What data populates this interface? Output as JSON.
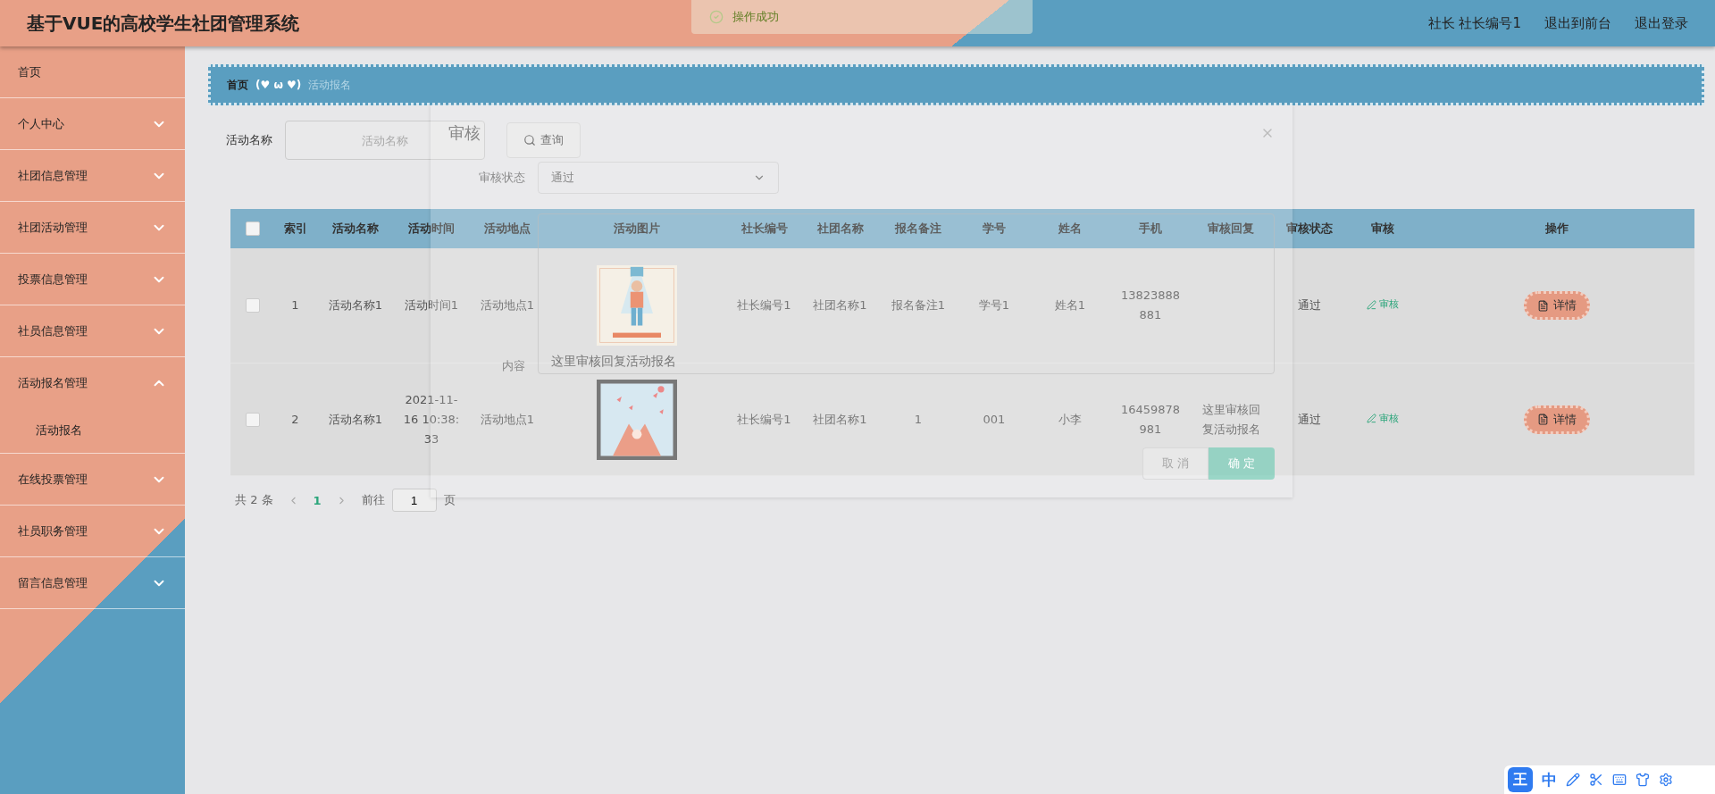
{
  "header": {
    "title": "基于VUE的高校学生社团管理系统",
    "user": "社长 社长编号1",
    "links": [
      "退出到前台",
      "退出登录"
    ]
  },
  "toast": {
    "message": "操作成功"
  },
  "sidebar": {
    "items": [
      {
        "label": "首页"
      },
      {
        "label": "个人中心",
        "expanded": false
      },
      {
        "label": "社团信息管理",
        "expanded": false
      },
      {
        "label": "社团活动管理",
        "expanded": false
      },
      {
        "label": "投票信息管理",
        "expanded": false
      },
      {
        "label": "社员信息管理",
        "expanded": false
      },
      {
        "label": "活动报名管理",
        "expanded": true,
        "children": [
          {
            "label": "活动报名"
          }
        ]
      },
      {
        "label": "在线投票管理",
        "expanded": false
      },
      {
        "label": "社员职务管理",
        "expanded": false
      },
      {
        "label": "留言信息管理",
        "expanded": false
      }
    ]
  },
  "breadcrumb": {
    "home": "首页",
    "separator": "(♥ ω ♥)",
    "current": "活动报名"
  },
  "search": {
    "label": "活动名称",
    "placeholder": "活动名称",
    "button": "查询"
  },
  "table": {
    "columns": [
      "索引",
      "活动名称",
      "活动时间",
      "活动地点",
      "活动图片",
      "社长编号",
      "社团名称",
      "报名备注",
      "学号",
      "姓名",
      "手机",
      "审核回复",
      "审核状态",
      "审核",
      "操作"
    ],
    "all_checked": false,
    "rows": [
      {
        "checked": false,
        "cells": [
          "1",
          "活动名称1",
          "活动时间1",
          "活动地点1",
          {
            "kind": "picture"
          },
          "社长编号1",
          "社团名称1",
          "报名备注1",
          "学号1",
          "姓名1",
          "13823888881",
          "",
          "通过"
        ],
        "review": "审核",
        "action": "详情"
      },
      {
        "checked": false,
        "cells": [
          "2",
          "活动名称1",
          "2021-11-16 10:38:33",
          "活动地点1",
          {
            "kind": "picture"
          },
          "社长编号1",
          "社团名称1",
          "1",
          "001",
          "小李",
          "16459878981",
          "这里审核回复活动报名",
          "通过"
        ],
        "review": "审核",
        "action": "详情"
      }
    ]
  },
  "pagination": {
    "total": "共 2 条",
    "pages": [
      {
        "label": "1",
        "selected": true
      }
    ],
    "goto": "前往",
    "goto_value": "1",
    "unit": "页"
  },
  "dialog": {
    "title": "审核",
    "status_label": "审核状态",
    "status_value": "通过",
    "content_label": "内容",
    "content_value": "这里审核回复活动报名",
    "buttons": [
      "取 消",
      "确 定"
    ]
  },
  "ime": {
    "badge": "王",
    "mode": "中"
  }
}
